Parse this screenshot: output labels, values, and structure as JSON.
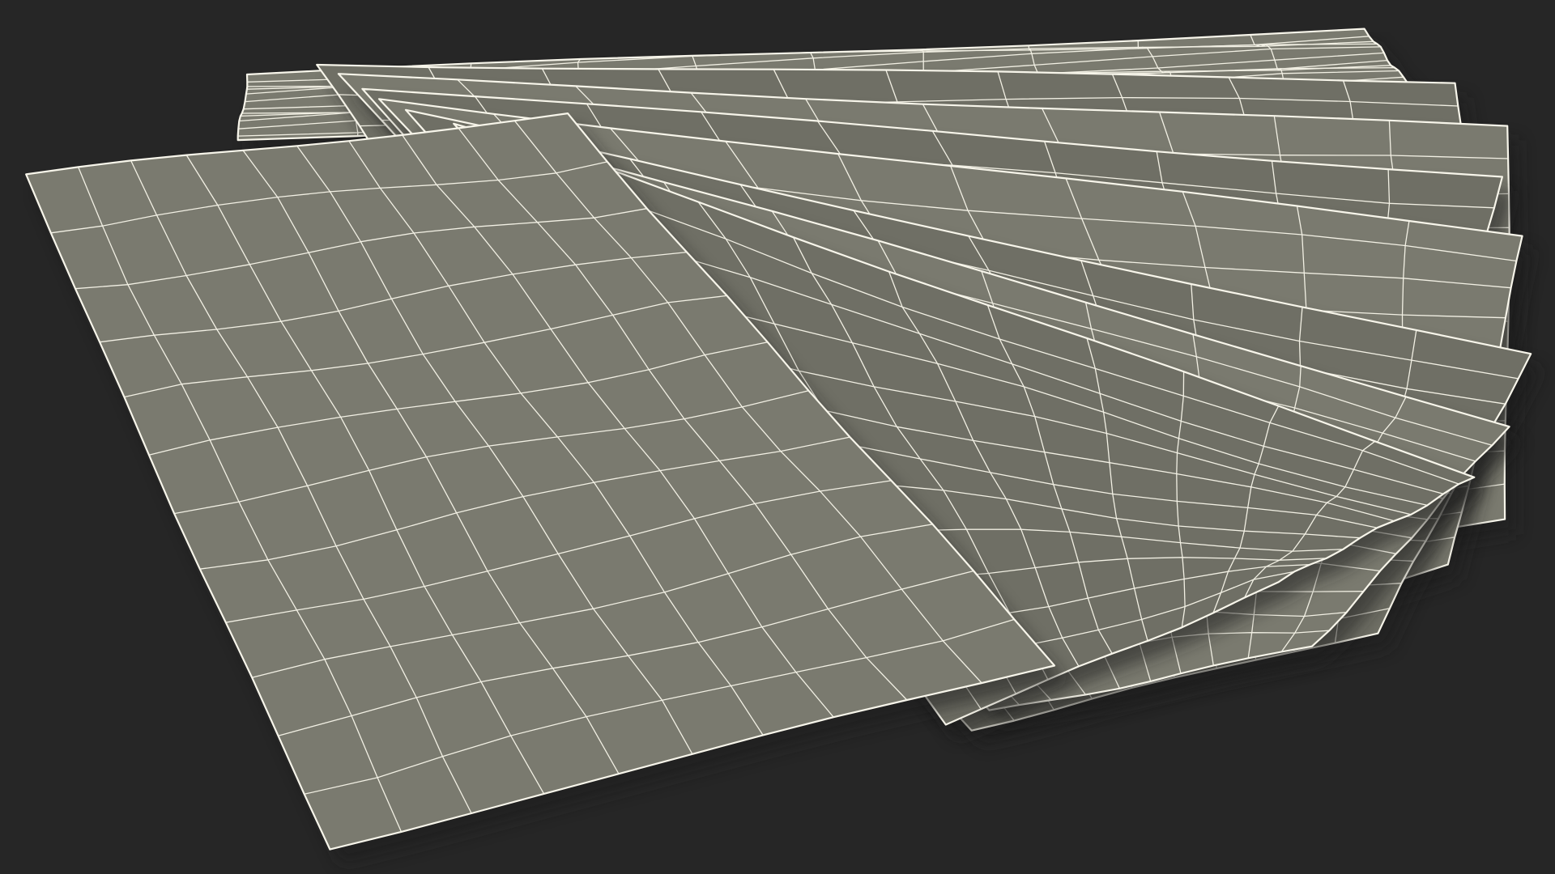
{
  "viewport": {
    "background_color": "#262626"
  },
  "model": {
    "object": "fanned-paper-sheets-wireframe",
    "sheet_count": 9,
    "grid_divisions_u": 10,
    "grid_divisions_v": 12,
    "surface_color": "#7a7a6f",
    "surface_shade_color": "#6f6f65",
    "wire_color": "#f2f0e4",
    "shadow_color": "#1e1e1b"
  }
}
